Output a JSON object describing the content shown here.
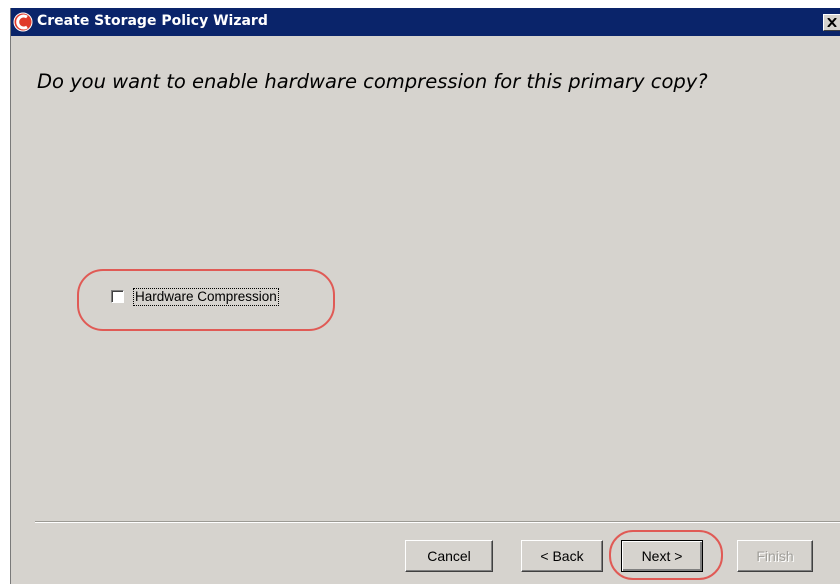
{
  "window": {
    "title": "Create Storage Policy Wizard",
    "title_bar_color": "#0a246a",
    "background_color": "#d6d3ce",
    "app_icon": "commvault-logo-icon",
    "close_icon": "close-icon"
  },
  "main": {
    "question": "Do you want to enable hardware compression for this primary copy?",
    "checkbox": {
      "label": "Hardware Compression",
      "checked": false
    }
  },
  "annotations": {
    "highlight_color": "#e05a55"
  },
  "buttons": {
    "cancel": "Cancel",
    "back": "< Back",
    "next": "Next >",
    "finish": "Finish",
    "finish_enabled": false
  }
}
